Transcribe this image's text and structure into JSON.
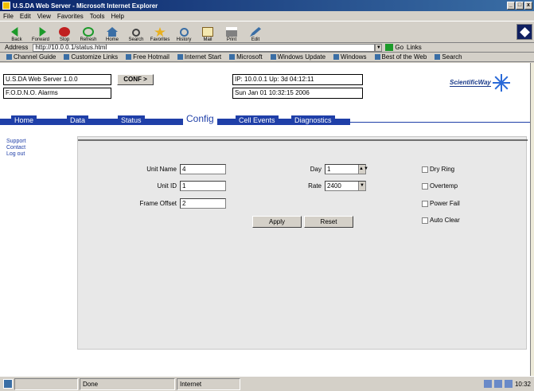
{
  "window": {
    "title": "U.S.DA Web Server - Microsoft Internet Explorer",
    "controls": {
      "minimize": "_",
      "maximize": "□",
      "close": "x"
    }
  },
  "menu": [
    "File",
    "Edit",
    "View",
    "Favorites",
    "Tools",
    "Help"
  ],
  "toolbar": [
    {
      "label": "Back",
      "icon": "back-arrow-icon"
    },
    {
      "label": "Forward",
      "icon": "forward-arrow-icon"
    },
    {
      "label": "Stop",
      "icon": "stop-icon"
    },
    {
      "label": "Refresh",
      "icon": "refresh-icon"
    },
    {
      "label": "Home",
      "icon": "home-icon"
    },
    {
      "label": "Search",
      "icon": "search-icon"
    },
    {
      "label": "Favorites",
      "icon": "favorites-icon"
    },
    {
      "label": "History",
      "icon": "history-icon"
    },
    {
      "label": "Mail",
      "icon": "mail-icon"
    },
    {
      "label": "Print",
      "icon": "print-icon"
    },
    {
      "label": "Edit",
      "icon": "edit-icon"
    }
  ],
  "address": {
    "label": "Address",
    "value": "http://10.0.0.1/status.html",
    "go_label": "Go",
    "links_label": "Links"
  },
  "links": [
    "Channel Guide",
    "Customize Links",
    "Free Hotmail",
    "Internet Start",
    "Microsoft",
    "Windows Update",
    "Windows",
    "Best of the Web",
    "Search"
  ],
  "header": {
    "left_top": "U.S.DA Web Server 1.0.0",
    "left_bottom": "F.O.D.N.O. Alarms",
    "conf_button": "CONF >",
    "mid_top": "IP: 10.0.0.1  Up: 3d 04:12:11",
    "mid_bottom": "Sun Jan 01 10:32:15 2006",
    "logo_text": "ScientificWay"
  },
  "nav": {
    "tabs": [
      "Home",
      "Data",
      "Status",
      "Config",
      "Cell Events",
      "Diagnostics"
    ],
    "active": "Config"
  },
  "side_links": [
    "Support",
    "Contact",
    "Log out"
  ],
  "form": {
    "fields": [
      {
        "label": "Unit Name",
        "value": "4"
      },
      {
        "label": "Unit ID",
        "value": "1"
      },
      {
        "label": "Frame Offset",
        "value": "2"
      }
    ],
    "selects": [
      {
        "label": "Day",
        "value": "1"
      },
      {
        "label": "Rate",
        "value": "2400"
      }
    ],
    "checkboxes": [
      "Dry Ring",
      "Overtemp",
      "Power Fail",
      "Auto Clear"
    ],
    "buttons": {
      "apply": "Apply",
      "reset": "Reset"
    }
  },
  "status": {
    "text": "Done",
    "zone": "Internet",
    "clock": "10:32"
  }
}
